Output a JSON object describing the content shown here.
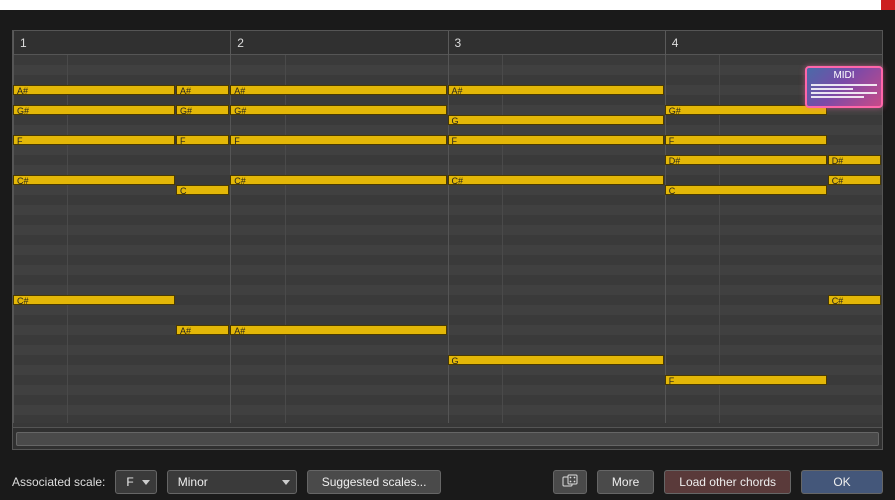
{
  "bars": [
    "1",
    "2",
    "3",
    "4"
  ],
  "midi_badge": {
    "label": "MIDI"
  },
  "notes": [
    {
      "pitch": "A#",
      "row": 3,
      "start": 0.0,
      "len": 0.75
    },
    {
      "pitch": "A#",
      "row": 3,
      "start": 0.75,
      "len": 0.25
    },
    {
      "pitch": "A#",
      "row": 3,
      "start": 1.0,
      "len": 1.0
    },
    {
      "pitch": "A#",
      "row": 3,
      "start": 2.0,
      "len": 1.0
    },
    {
      "pitch": "G#",
      "row": 5,
      "start": 0.0,
      "len": 0.75
    },
    {
      "pitch": "G#",
      "row": 5,
      "start": 0.75,
      "len": 0.25
    },
    {
      "pitch": "G#",
      "row": 5,
      "start": 1.0,
      "len": 1.0
    },
    {
      "pitch": "G",
      "row": 6,
      "start": 2.0,
      "len": 1.0
    },
    {
      "pitch": "G#",
      "row": 5,
      "start": 3.0,
      "len": 0.75
    },
    {
      "pitch": "F",
      "row": 8,
      "start": 0.0,
      "len": 0.75
    },
    {
      "pitch": "F",
      "row": 8,
      "start": 0.75,
      "len": 0.25
    },
    {
      "pitch": "F",
      "row": 8,
      "start": 1.0,
      "len": 1.0
    },
    {
      "pitch": "F",
      "row": 8,
      "start": 2.0,
      "len": 1.0
    },
    {
      "pitch": "F",
      "row": 8,
      "start": 3.0,
      "len": 0.75
    },
    {
      "pitch": "D#",
      "row": 10,
      "start": 3.0,
      "len": 0.75
    },
    {
      "pitch": "D#",
      "row": 10,
      "start": 3.75,
      "len": 0.25
    },
    {
      "pitch": "C#",
      "row": 12,
      "start": 0.0,
      "len": 0.75
    },
    {
      "pitch": "C",
      "row": 13,
      "start": 0.75,
      "len": 0.25
    },
    {
      "pitch": "C#",
      "row": 12,
      "start": 1.0,
      "len": 1.0
    },
    {
      "pitch": "C#",
      "row": 12,
      "start": 2.0,
      "len": 1.0
    },
    {
      "pitch": "C",
      "row": 13,
      "start": 3.0,
      "len": 0.75
    },
    {
      "pitch": "C#",
      "row": 12,
      "start": 3.75,
      "len": 0.25
    },
    {
      "pitch": "C#",
      "row": 24,
      "start": 0.0,
      "len": 0.75
    },
    {
      "pitch": "C#",
      "row": 24,
      "start": 3.75,
      "len": 0.25
    },
    {
      "pitch": "A#",
      "row": 27,
      "start": 0.75,
      "len": 0.25
    },
    {
      "pitch": "A#",
      "row": 27,
      "start": 1.0,
      "len": 1.0
    },
    {
      "pitch": "G",
      "row": 30,
      "start": 2.0,
      "len": 1.0
    },
    {
      "pitch": "F",
      "row": 32,
      "start": 3.0,
      "len": 0.75
    }
  ],
  "grid": {
    "rows": 37,
    "bars": 4
  },
  "bottom": {
    "scale_label": "Associated scale:",
    "root": "F",
    "mode": "Minor",
    "suggested": "Suggested scales...",
    "more": "More",
    "load": "Load other chords",
    "ok": "OK"
  }
}
